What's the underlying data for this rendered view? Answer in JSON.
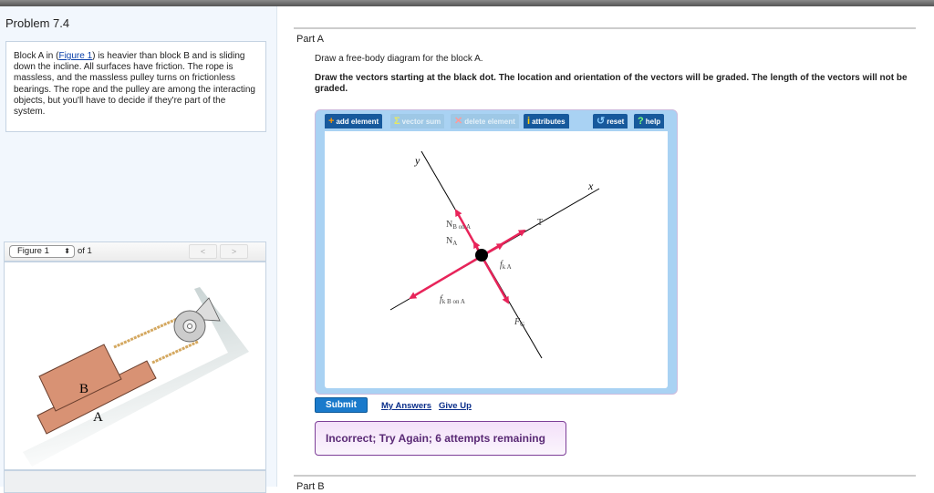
{
  "problem_title": "Problem 7.4",
  "description": {
    "before": "Block A in (",
    "link": "Figure 1",
    "after": ") is heavier than block B and is sliding down the incline. All surfaces have friction. The rope is massless, and the massless pulley turns on frictionless bearings. The rope and the pulley are among the interacting objects, but you'll have to decide if they're part of the system."
  },
  "figure": {
    "selected": "Figure 1",
    "of": "of 1",
    "prev": "<",
    "next": ">",
    "labels": {
      "block_b": "B",
      "block_a": "A"
    }
  },
  "part_a": {
    "title": "Part A",
    "question": "Draw a free-body diagram for the block A.",
    "instructions": "Draw the vectors starting at the black dot. The location and orientation of the vectors will be graded. The length of the vectors will not be graded."
  },
  "toolbar": {
    "add": "add element",
    "sum": "vector sum",
    "delete": "delete element",
    "attributes": "attributes",
    "reset": "reset",
    "help": "help"
  },
  "diagram": {
    "axis_x": "x",
    "axis_y": "y",
    "vectors": [
      {
        "label": "N",
        "sub": "B on A"
      },
      {
        "label": "N",
        "sub": "A"
      },
      {
        "label": "T",
        "sub": ""
      },
      {
        "label": "f",
        "sub": "k A"
      },
      {
        "label": "f",
        "sub": "k B on A"
      },
      {
        "label": "F",
        "sub": "G"
      }
    ],
    "vector_color": "#e8245a"
  },
  "actions": {
    "submit": "Submit",
    "my_answers": "My Answers",
    "give_up": "Give Up"
  },
  "feedback": "Incorrect; Try Again; 6 attempts remaining",
  "part_b": {
    "title": "Part B"
  }
}
